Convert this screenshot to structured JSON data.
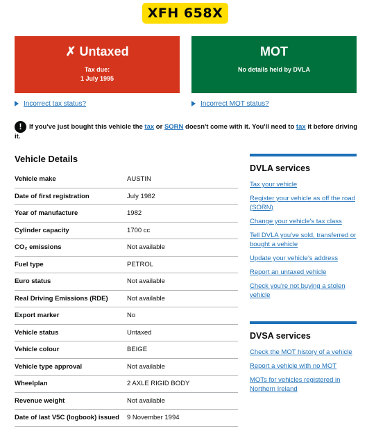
{
  "plate": "XFH 658X",
  "tax_panel": {
    "title": "Untaxed",
    "icon": "cross-icon",
    "due_label": "Tax due:",
    "due_date": "1 July 1995",
    "color": "#d4351c"
  },
  "mot_panel": {
    "title": "MOT",
    "status": "No details held by DVLA",
    "color": "#00703c"
  },
  "links": {
    "incorrect_tax": "Incorrect tax status?",
    "incorrect_mot": "Incorrect MOT status?"
  },
  "warning": {
    "p1": "If you've just bought this vehicle the ",
    "tax1": "tax",
    "p2": " or ",
    "sorn": "SORN",
    "p3": " doesn't come with it. You'll need to ",
    "tax2": "tax",
    "p4": " it before driving it."
  },
  "vehicle_details": {
    "title": "Vehicle Details",
    "rows": [
      {
        "k": "Vehicle make",
        "v": "AUSTIN"
      },
      {
        "k": "Date of first registration",
        "v": "July 1982"
      },
      {
        "k": "Year of manufacture",
        "v": "1982"
      },
      {
        "k": "Cylinder capacity",
        "v": "1700 cc"
      },
      {
        "k": "CO₂ emissions",
        "v": "Not available"
      },
      {
        "k": "Fuel type",
        "v": "PETROL"
      },
      {
        "k": "Euro status",
        "v": "Not available"
      },
      {
        "k": "Real Driving Emissions (RDE)",
        "v": "Not available"
      },
      {
        "k": "Export marker",
        "v": "No"
      },
      {
        "k": "Vehicle status",
        "v": "Untaxed"
      },
      {
        "k": "Vehicle colour",
        "v": "BEIGE"
      },
      {
        "k": "Vehicle type approval",
        "v": "Not available"
      },
      {
        "k": "Wheelplan",
        "v": "2 AXLE RIGID BODY"
      },
      {
        "k": "Revenue weight",
        "v": "Not available"
      },
      {
        "k": "Date of last V5C (logbook) issued",
        "v": "9 November 1994"
      }
    ]
  },
  "dvla": {
    "title": "DVLA services",
    "items": [
      "Tax your vehicle",
      "Register your vehicle as off the road (SORN)",
      "Change your vehicle's tax class",
      "Tell DVLA you've sold, transferred or bought a vehicle",
      "Update your vehicle's address",
      "Report an untaxed vehicle",
      "Check you're not buying a stolen vehicle"
    ]
  },
  "dvsa": {
    "title": "DVSA services",
    "items": [
      "Check the MOT history of a vehicle",
      "Report a vehicle with no MOT",
      "MOTs for vehicles registered in Northern Ireland"
    ]
  },
  "colors": {
    "link": "#1d70b8",
    "plate": "#ffdd00",
    "text": "#0b0c0c"
  }
}
